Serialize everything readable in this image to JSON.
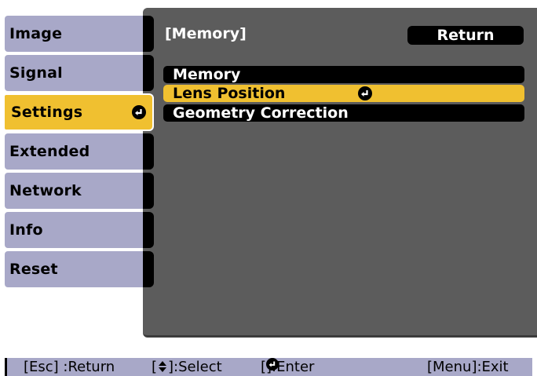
{
  "menu": {
    "items": [
      {
        "label": "Image",
        "active": false
      },
      {
        "label": "Signal",
        "active": false
      },
      {
        "label": "Settings",
        "active": true
      },
      {
        "label": "Extended",
        "active": false
      },
      {
        "label": "Network",
        "active": false
      },
      {
        "label": "Info",
        "active": false
      },
      {
        "label": "Reset",
        "active": false
      }
    ]
  },
  "panel": {
    "title": "[Memory]",
    "return_label": "Return",
    "items": [
      {
        "label": "Memory",
        "active": false
      },
      {
        "label": "Lens Position",
        "active": true
      },
      {
        "label": "Geometry Correction",
        "active": false
      }
    ]
  },
  "help_bar": {
    "return_hint": "[Esc] :Return",
    "select_hint_prefix": "[",
    "select_hint_suffix": "]:Select",
    "enter_hint_prefix": "[",
    "enter_hint_suffix": "]:Enter",
    "exit_hint": "[Menu]:Exit"
  },
  "colors": {
    "tab_bg": "#a8a8c8",
    "active_bg": "#f0c030",
    "panel_bg": "#5c5c5c",
    "item_bg": "#000000"
  },
  "icons": {
    "enter": "enter-icon",
    "updown": "up-down-arrow-icon"
  }
}
